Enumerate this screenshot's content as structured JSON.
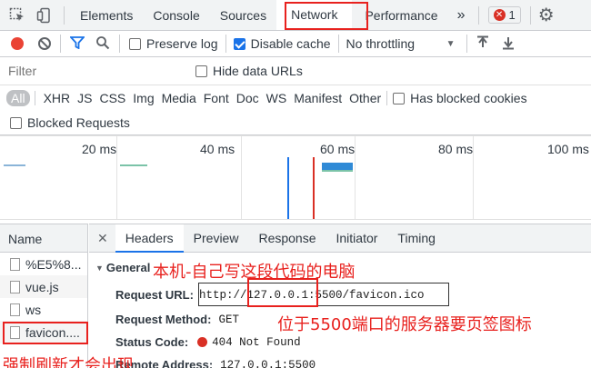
{
  "toolbar": {
    "tabs": [
      "Elements",
      "Console",
      "Sources",
      "Network",
      "Performance"
    ],
    "active_tab": "Network",
    "more": "»",
    "error_count": "1"
  },
  "network_toolbar": {
    "preserve_log": "Preserve log",
    "disable_cache": "Disable cache",
    "throttling": "No throttling"
  },
  "filter": {
    "placeholder": "Filter",
    "hide_data_urls": "Hide data URLs"
  },
  "types": [
    "All",
    "XHR",
    "JS",
    "CSS",
    "Img",
    "Media",
    "Font",
    "Doc",
    "WS",
    "Manifest",
    "Other"
  ],
  "has_blocked_cookies": "Has blocked cookies",
  "blocked_requests": "Blocked Requests",
  "timeline": {
    "ticks": [
      "20 ms",
      "40 ms",
      "60 ms",
      "80 ms",
      "100 ms"
    ]
  },
  "requests": {
    "header": "Name",
    "items": [
      "%E5%8...",
      "vue.js",
      "ws",
      "favicon...."
    ]
  },
  "details": {
    "tabs": [
      "Headers",
      "Preview",
      "Response",
      "Initiator",
      "Timing"
    ],
    "section": "General",
    "request_url_label": "Request URL:",
    "request_url": "http://127.0.0.1:5500/favicon.ico",
    "request_method_label": "Request Method:",
    "request_method": "GET",
    "status_code_label": "Status Code:",
    "status_code": "404 Not Found",
    "remote_address_label": "Remote Address:",
    "remote_address": "127.0.0.1:5500"
  },
  "annotations": {
    "localhost": "本机-自己写这段代码的电脑",
    "port": "位于5500端口的服务器要页签图标",
    "refresh": "强制刷新才会出现"
  },
  "colors": {
    "accent": "#1a73e8",
    "record": "#ea4335",
    "annotation": "#e8211e"
  }
}
